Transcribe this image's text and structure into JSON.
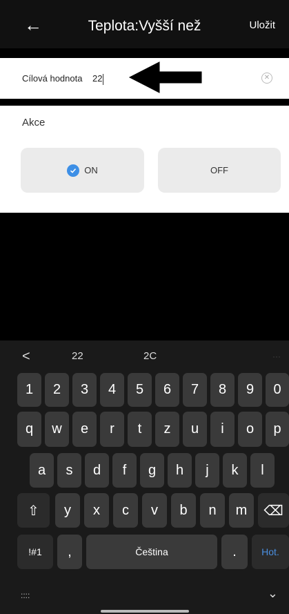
{
  "header": {
    "back_icon": "←",
    "title": "Teplota:Vyšší než",
    "save_label": "Uložit"
  },
  "input": {
    "label": "Cílová hodnota",
    "value": "22",
    "clear_icon": "⊗"
  },
  "action": {
    "label": "Akce",
    "on_label": "ON",
    "off_label": "OFF",
    "selected": "ON",
    "accent_color": "#3d8fe6"
  },
  "keyboard": {
    "suggestions": {
      "back": "<",
      "s1": "22",
      "s2": "2C",
      "more": "···"
    },
    "numbers": [
      "1",
      "2",
      "3",
      "4",
      "5",
      "6",
      "7",
      "8",
      "9",
      "0"
    ],
    "row1": [
      "q",
      "w",
      "e",
      "r",
      "t",
      "z",
      "u",
      "i",
      "o",
      "p"
    ],
    "row2": [
      "a",
      "s",
      "d",
      "f",
      "g",
      "h",
      "j",
      "k",
      "l"
    ],
    "row3": [
      "y",
      "x",
      "c",
      "v",
      "b",
      "n",
      "m"
    ],
    "shift_icon": "⇧",
    "backspace_icon": "⌫",
    "symbols_label": "!#1",
    "comma_label": ",",
    "space_label": "Čeština",
    "period_label": ".",
    "action_label": "Hot.",
    "grid_icon": "::::",
    "hide_icon": "⌄"
  }
}
